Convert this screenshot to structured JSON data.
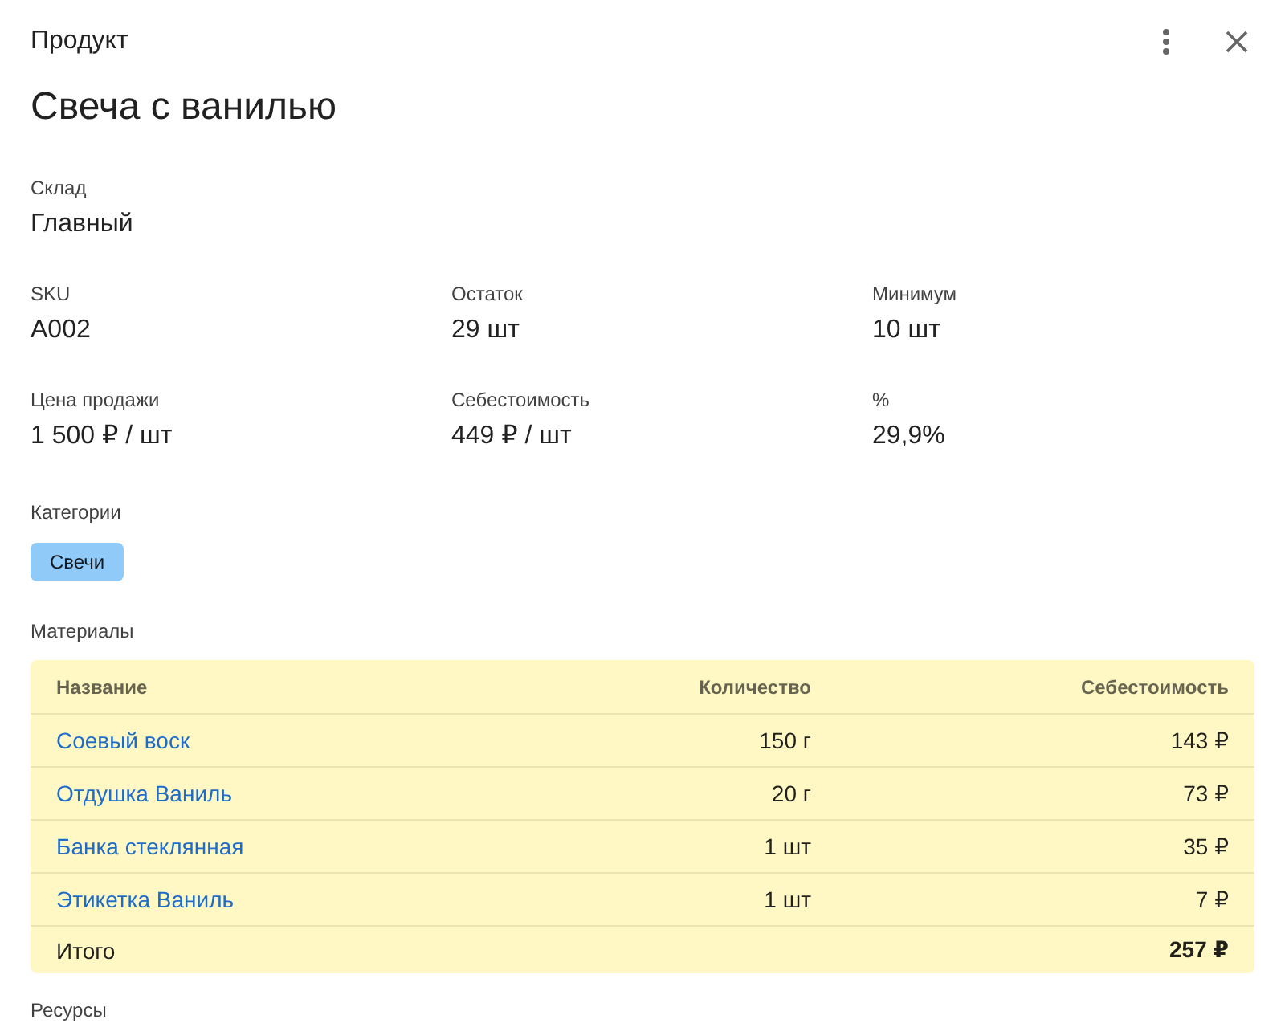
{
  "dialog": {
    "title": "Продукт"
  },
  "product": {
    "name": "Свеча с ванилью"
  },
  "warehouse": {
    "label": "Склад",
    "value": "Главный"
  },
  "fields": [
    {
      "label": "SKU",
      "value": "A002"
    },
    {
      "label": "Остаток",
      "value": "29 шт"
    },
    {
      "label": "Минимум",
      "value": "10 шт"
    },
    {
      "label": "Цена продажи",
      "value": "1 500 ₽ / шт"
    },
    {
      "label": "Себестоимость",
      "value": "449 ₽ / шт"
    },
    {
      "label": "%",
      "value": "29,9%"
    }
  ],
  "categories": {
    "label": "Категории",
    "items": [
      {
        "label": "Свечи",
        "color": "#90caf9"
      }
    ]
  },
  "materials": {
    "label": "Материалы",
    "columns": [
      "Название",
      "Количество",
      "Себестоимость"
    ],
    "rows": [
      {
        "name": "Соевый воск",
        "quantity": "150 г",
        "cost": "143 ₽"
      },
      {
        "name": "Отдушка Ваниль",
        "quantity": "20 г",
        "cost": "73 ₽"
      },
      {
        "name": "Банка стеклянная",
        "quantity": "1 шт",
        "cost": "35 ₽"
      },
      {
        "name": "Этикетка Ваниль",
        "quantity": "1 шт",
        "cost": "7 ₽"
      }
    ],
    "total": {
      "label": "Итого",
      "cost": "257 ₽"
    }
  },
  "resources": {
    "label": "Ресурсы"
  }
}
